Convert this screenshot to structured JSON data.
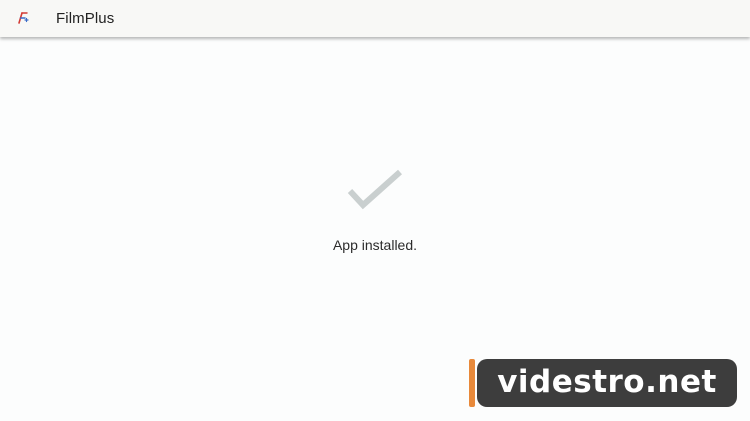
{
  "app": {
    "title": "FilmPlus",
    "icon": "filmplus-logo-icon"
  },
  "install": {
    "icon": "checkmark-icon",
    "status": "App installed."
  },
  "watermark": {
    "text": "videstro.net"
  },
  "colors": {
    "appbar_bg": "#f8f8f6",
    "content_bg": "#fcfdfd",
    "checkmark": "#c9cfcf",
    "watermark_bg": "#3d3d3d",
    "watermark_accent": "#e8893a"
  }
}
